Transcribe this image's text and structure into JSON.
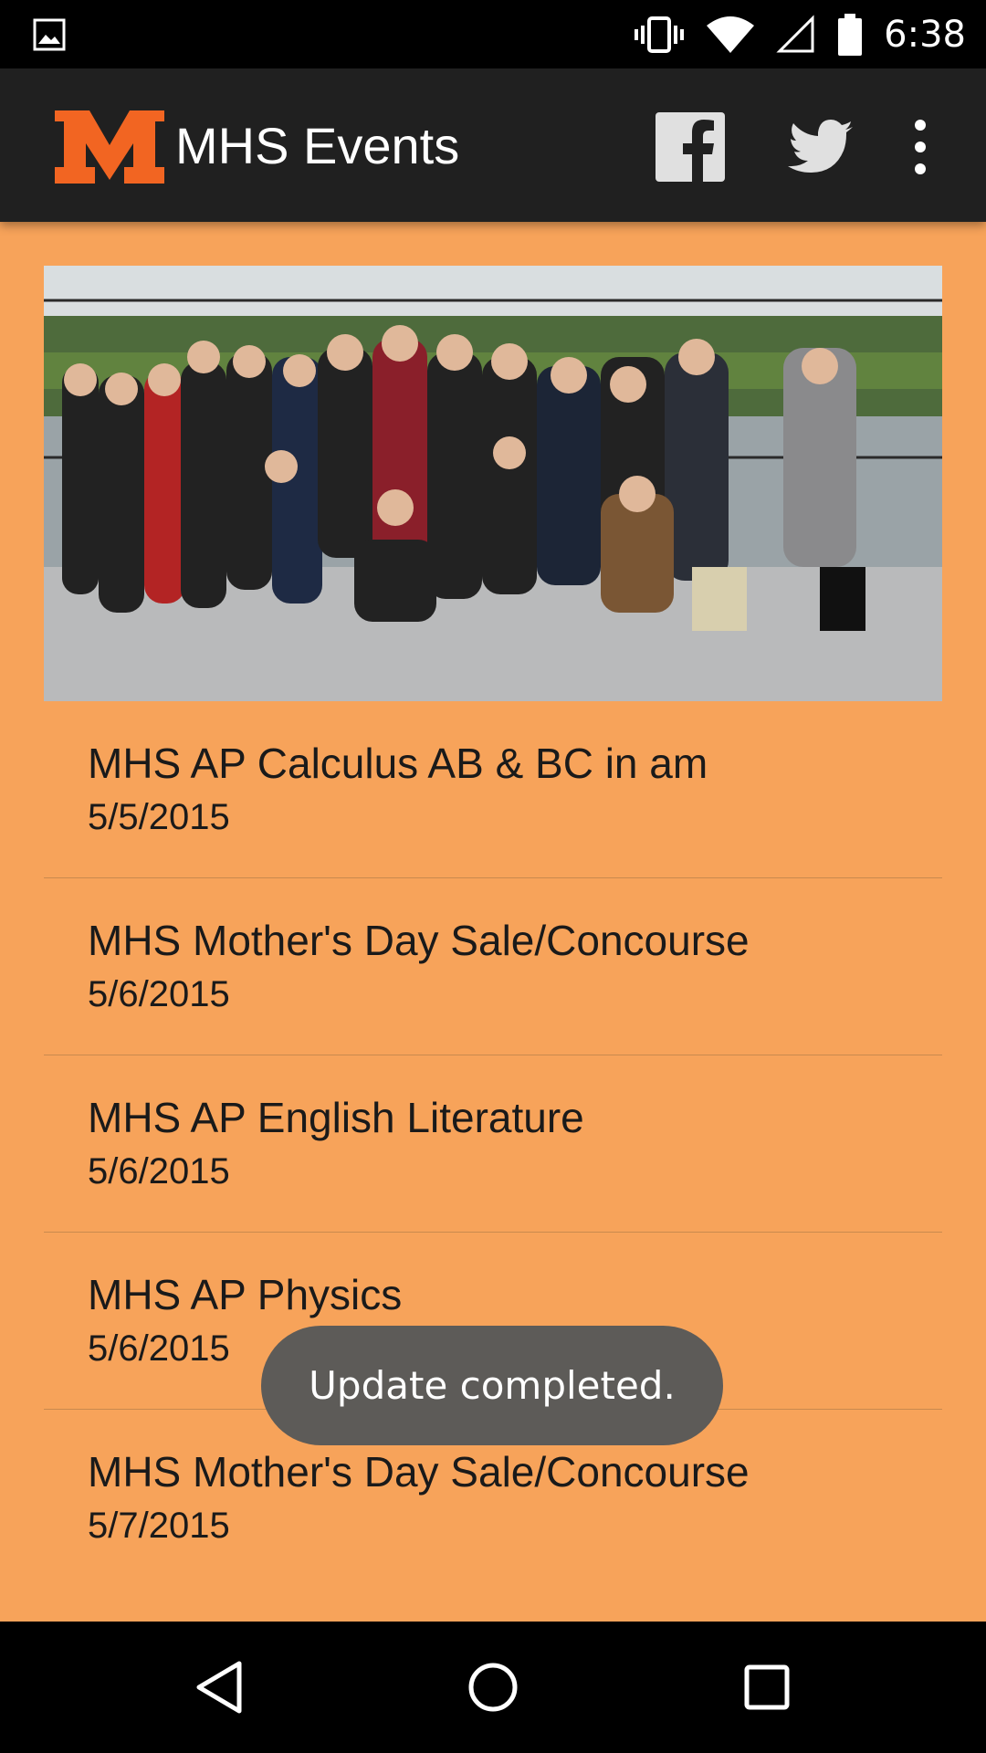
{
  "status_bar": {
    "time": "6:38",
    "icons": [
      "gallery-icon",
      "vibrate-icon",
      "wifi-icon",
      "signal-icon",
      "battery-icon"
    ]
  },
  "app_bar": {
    "logo": "M",
    "title": "MHS Events",
    "actions": [
      "facebook-icon",
      "twitter-icon",
      "more-vert-icon"
    ]
  },
  "colors": {
    "app_bar_bg": "#202020",
    "content_bg": "#f7a35a",
    "logo_orange": "#f26522",
    "toast_bg": "#5d5b58"
  },
  "events": [
    {
      "title": "MHS AP Calculus AB & BC in am",
      "date": "5/5/2015"
    },
    {
      "title": "MHS Mother's Day Sale/Concourse",
      "date": "5/6/2015"
    },
    {
      "title": "MHS AP English Literature",
      "date": "5/6/2015"
    },
    {
      "title": "MHS AP Physics",
      "date": "5/6/2015"
    },
    {
      "title": "MHS Mother's Day Sale/Concourse",
      "date": "5/7/2015"
    }
  ],
  "toast": {
    "message": "Update completed."
  },
  "nav_bar": {
    "buttons": [
      "back-icon",
      "home-icon",
      "recents-icon"
    ]
  }
}
